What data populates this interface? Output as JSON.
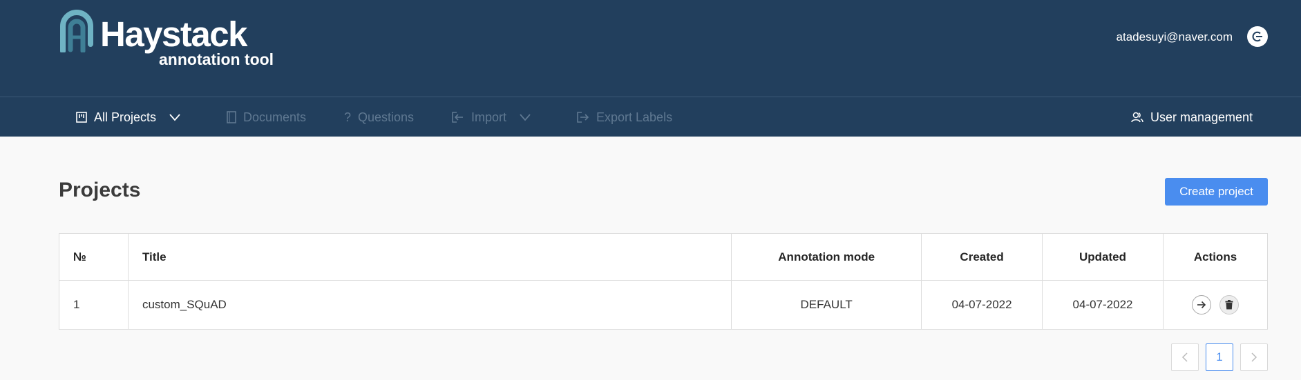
{
  "header": {
    "logo_text": "Haystack",
    "logo_subtitle": "annotation tool",
    "user_email": "atadesuyi@naver.com",
    "logout_icon": "logout-icon",
    "background": "#223f5d"
  },
  "nav": {
    "items": [
      {
        "label": "All Projects",
        "icon": "projects-icon",
        "dropdown": true,
        "enabled": true
      },
      {
        "label": "Documents",
        "icon": "document-icon",
        "dropdown": false,
        "enabled": false
      },
      {
        "label": "Questions",
        "icon": "question-icon",
        "dropdown": false,
        "enabled": false
      },
      {
        "label": "Import",
        "icon": "import-icon",
        "dropdown": true,
        "enabled": false
      },
      {
        "label": "Export Labels",
        "icon": "export-icon",
        "dropdown": false,
        "enabled": false
      }
    ],
    "user_management": {
      "label": "User management",
      "icon": "users-icon"
    }
  },
  "main": {
    "title": "Projects",
    "create_button": "Create project",
    "accent_color": "#4a8def"
  },
  "table": {
    "headers": [
      "№",
      "Title",
      "Annotation mode",
      "Created",
      "Updated",
      "Actions"
    ],
    "rows": [
      {
        "number": "1",
        "title": "custom_SQuAD",
        "mode": "DEFAULT",
        "created": "04-07-2022",
        "updated": "04-07-2022"
      }
    ]
  },
  "pagination": {
    "current_page": "1",
    "prev_icon": "chevron-left-icon",
    "next_icon": "chevron-right-icon"
  }
}
